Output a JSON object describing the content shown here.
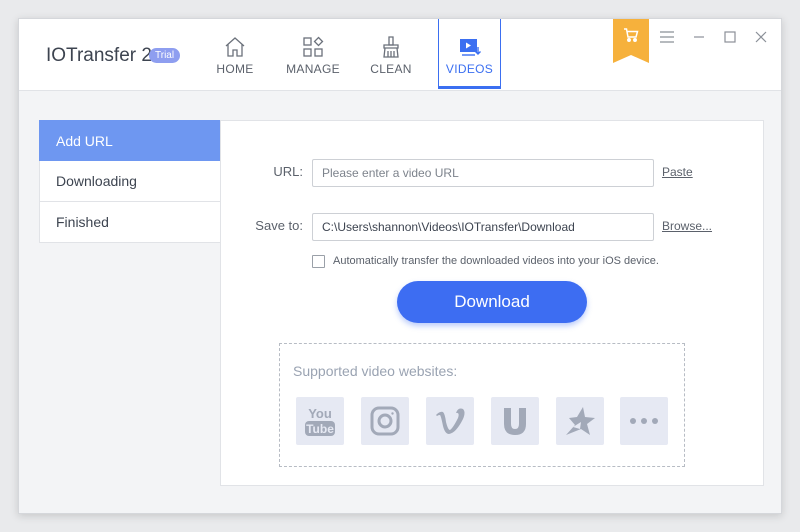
{
  "app": {
    "name": "IOTransfer 2",
    "badge": "Trial"
  },
  "nav": [
    {
      "label": "HOME",
      "icon": "home-icon"
    },
    {
      "label": "MANAGE",
      "icon": "manage-icon"
    },
    {
      "label": "CLEAN",
      "icon": "clean-icon"
    },
    {
      "label": "VIDEOS",
      "icon": "videos-icon",
      "active": true
    }
  ],
  "sidebar": {
    "items": [
      {
        "label": "Add URL",
        "active": true
      },
      {
        "label": "Downloading"
      },
      {
        "label": "Finished"
      }
    ]
  },
  "form": {
    "url_label": "URL:",
    "url_placeholder": "Please enter a video URL",
    "paste_label": "Paste",
    "save_label": "Save to:",
    "save_value": "C:\\Users\\shannon\\Videos\\IOTransfer\\Download",
    "browse_label": "Browse...",
    "auto_transfer_label": "Automatically transfer the downloaded videos into your iOS device.",
    "download_label": "Download"
  },
  "sites": {
    "title": "Supported video websites:",
    "items": [
      "youtube-icon",
      "instagram-icon",
      "vimeo-icon",
      "ustream-icon",
      "dailymotion-icon",
      "more-icon"
    ],
    "youtube_you": "You",
    "youtube_tube": "Tube"
  },
  "colors": {
    "accent": "#3b6ff1",
    "cart": "#f6b13c",
    "sidebar_active": "#6e97f1"
  }
}
